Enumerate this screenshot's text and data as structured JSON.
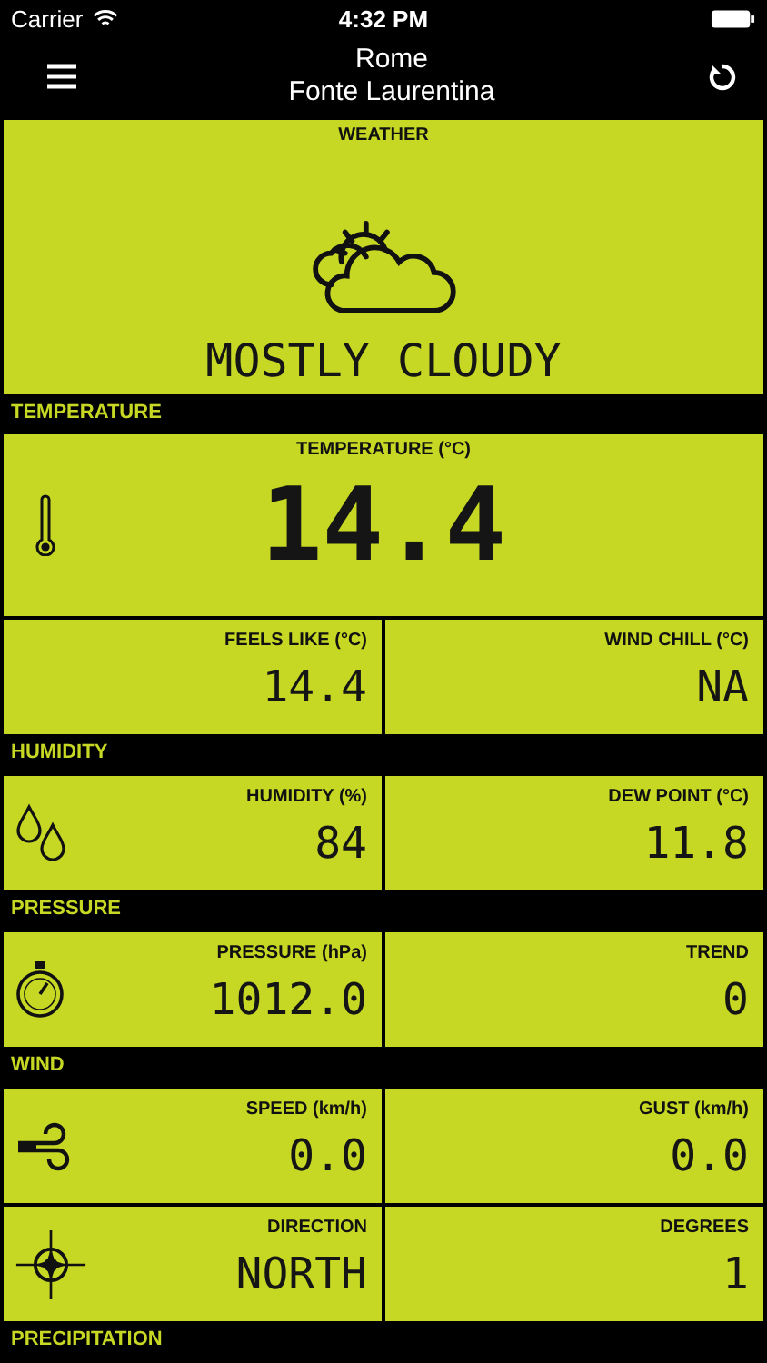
{
  "status_bar": {
    "carrier": "Carrier",
    "time": "4:32 PM"
  },
  "nav": {
    "city": "Rome",
    "station": "Fonte Laurentina"
  },
  "weather": {
    "label": "WEATHER",
    "condition": "MOSTLY CLOUDY"
  },
  "sections": [
    {
      "title": "TEMPERATURE",
      "rows": [
        {
          "kind": "wide",
          "cells": [
            {
              "label": "TEMPERATURE (°C)",
              "value": "14.4"
            }
          ]
        },
        {
          "kind": "pair",
          "cells": [
            {
              "label": "FEELS LIKE (°C)",
              "value": "14.4"
            },
            {
              "label": "WIND CHILL (°C)",
              "value": "NA"
            }
          ]
        }
      ]
    },
    {
      "title": "HUMIDITY",
      "rows": [
        {
          "kind": "pair",
          "cells": [
            {
              "label": "HUMIDITY (%)",
              "value": "84"
            },
            {
              "label": "DEW POINT (°C)",
              "value": "11.8"
            }
          ]
        }
      ]
    },
    {
      "title": "PRESSURE",
      "rows": [
        {
          "kind": "pair",
          "cells": [
            {
              "label": "PRESSURE (hPa)",
              "value": "1012.0"
            },
            {
              "label": "TREND",
              "value": "0"
            }
          ]
        }
      ]
    },
    {
      "title": "WIND",
      "rows": [
        {
          "kind": "pair",
          "cells": [
            {
              "label": "SPEED (km/h)",
              "value": "0.0"
            },
            {
              "label": "GUST (km/h)",
              "value": "0.0"
            }
          ]
        },
        {
          "kind": "pair",
          "cells": [
            {
              "label": "DIRECTION",
              "value": "NORTH"
            },
            {
              "label": "DEGREES",
              "value": "1"
            }
          ]
        }
      ]
    },
    {
      "title": "PRECIPITATION"
    }
  ]
}
